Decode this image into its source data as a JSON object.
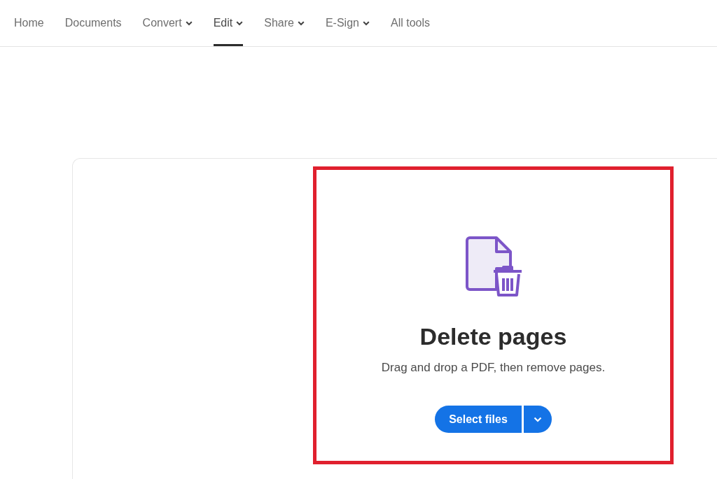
{
  "nav": {
    "tabs": [
      {
        "label": "Home",
        "has_menu": false,
        "selected": false
      },
      {
        "label": "Documents",
        "has_menu": false,
        "selected": false
      },
      {
        "label": "Convert",
        "has_menu": true,
        "selected": false
      },
      {
        "label": "Edit",
        "has_menu": true,
        "selected": true
      },
      {
        "label": "Share",
        "has_menu": true,
        "selected": false
      },
      {
        "label": "E-Sign",
        "has_menu": true,
        "selected": false
      },
      {
        "label": "All tools",
        "has_menu": false,
        "selected": false
      }
    ]
  },
  "tool": {
    "title": "Delete pages",
    "description": "Drag and drop a PDF, then remove pages.",
    "button": "Select files",
    "highlighted": true
  }
}
